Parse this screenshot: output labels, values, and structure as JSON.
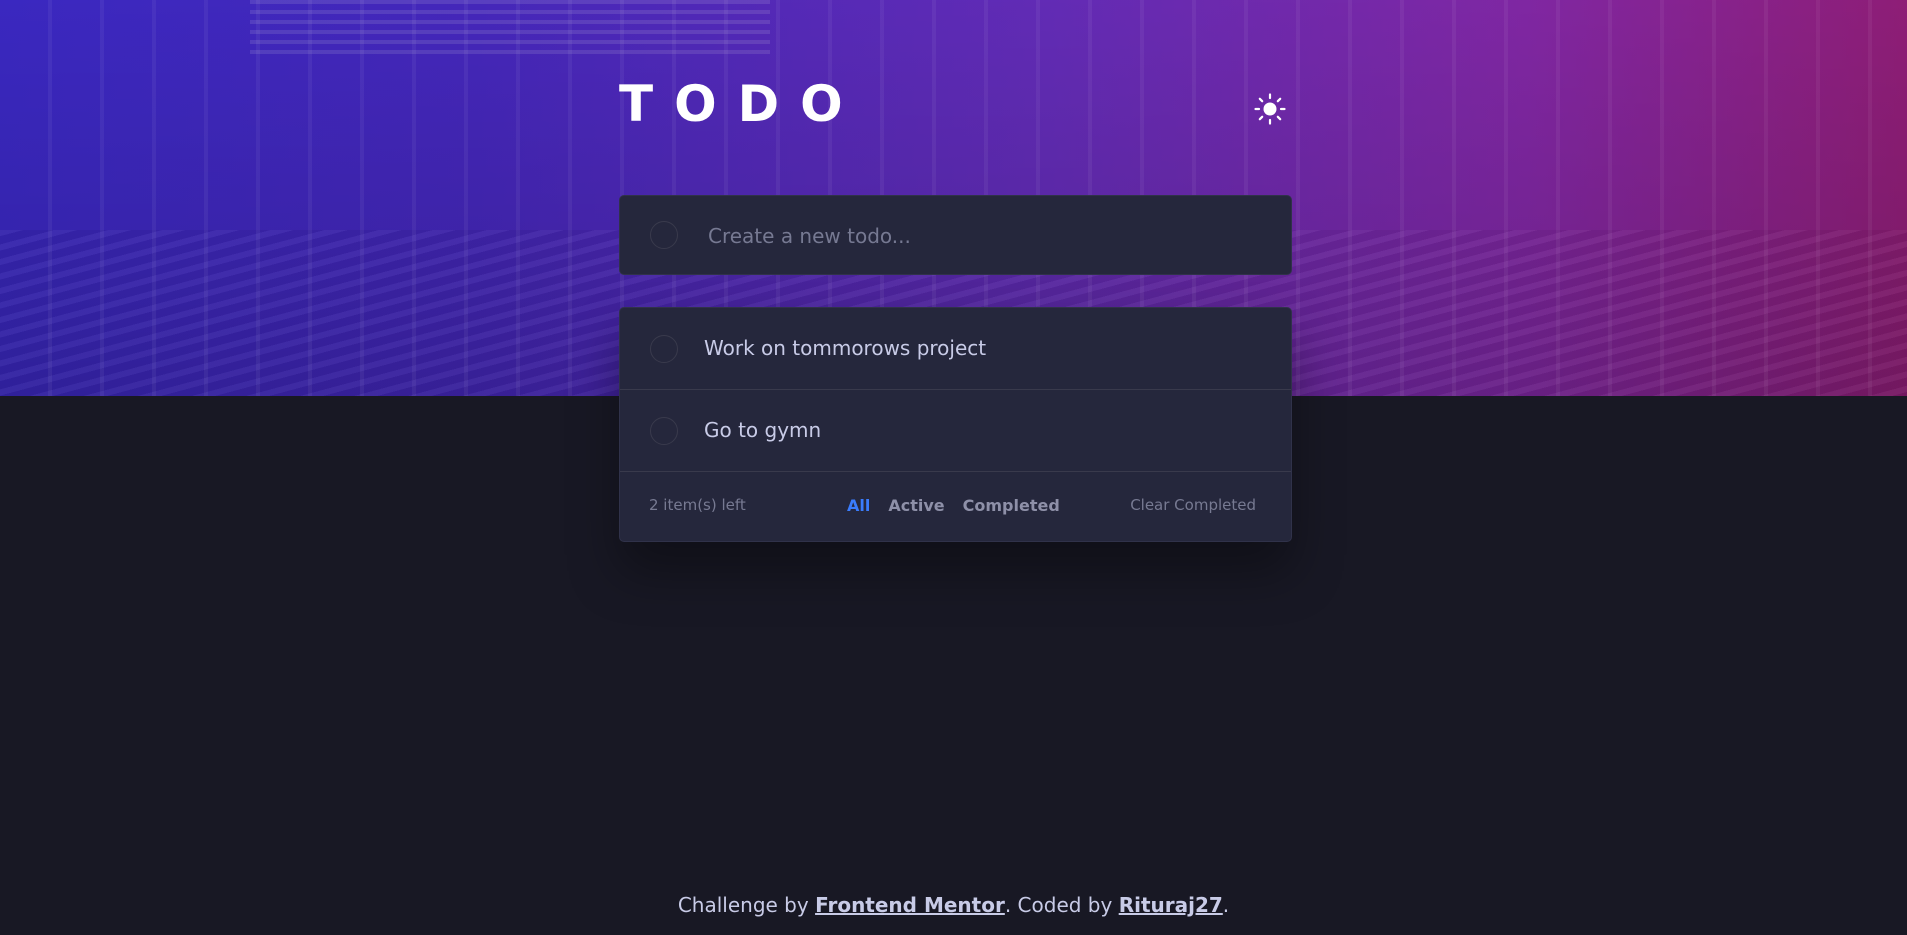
{
  "header": {
    "title": "TODO",
    "theme_icon": "sun-icon"
  },
  "new_todo": {
    "placeholder": "Create a new todo...",
    "value": ""
  },
  "todos": [
    {
      "text": "Work on tommorows project",
      "completed": false
    },
    {
      "text": "Go to gymn",
      "completed": false
    }
  ],
  "footer": {
    "items_left": "2 item(s) left",
    "filters": [
      "All",
      "Active",
      "Completed"
    ],
    "active_filter": "All",
    "clear_label": "Clear Completed"
  },
  "attribution": {
    "prefix": "Challenge by ",
    "link1": "Frontend Mentor",
    "middle": ". Coded by ",
    "link2": "Rituraj27",
    "suffix": "."
  },
  "colors": {
    "background": "#181824",
    "card": "#25273c",
    "accent": "#3a7cfd",
    "text": "#c8cbe7"
  }
}
